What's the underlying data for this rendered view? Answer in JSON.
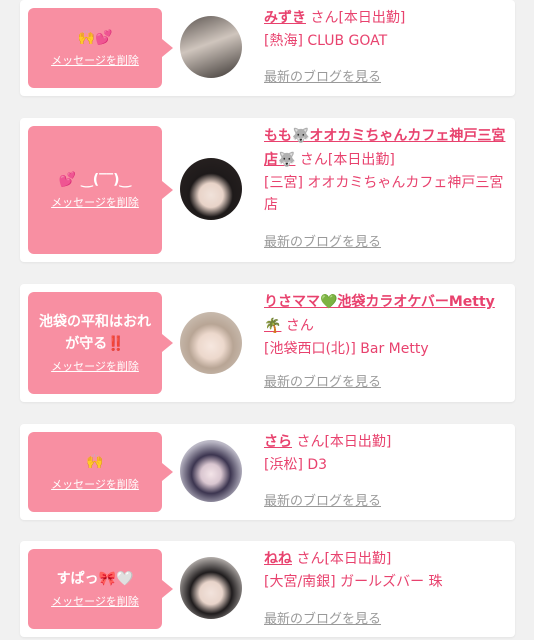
{
  "common": {
    "delete_label": "メッセージを削除",
    "blog_label": "最新のブログを見る",
    "san": "さん"
  },
  "cards": [
    {
      "message": "🙌💕",
      "name": "みずき",
      "status": "[本日出勤]",
      "shop": "[熱海] CLUB GOAT"
    },
    {
      "message": "💕 ‿(‾‾)‿",
      "name": "もも🐺オオカミちゃんカフェ神戸三宮店🐺",
      "status": "[本日出勤]",
      "shop": "[三宮] オオカミちゃんカフェ神戸三宮店"
    },
    {
      "message": "池袋の平和はおれが守る‼️",
      "name": "りさママ💚池袋カラオケバーMetty🌴",
      "status": "",
      "shop": "[池袋西口(北)] Bar Metty"
    },
    {
      "message": "🙌",
      "name": "さら",
      "status": "[本日出勤]",
      "shop": "[浜松] D3"
    },
    {
      "message": "すぱっ🎀🤍",
      "name": "ねね",
      "status": "[本日出勤]",
      "shop": "[大宮/南銀] ガールズバー 珠"
    }
  ],
  "colors": {
    "bubble": "#f88fa2",
    "accent": "#e8426e",
    "link_gray": "#9a9a9a"
  }
}
